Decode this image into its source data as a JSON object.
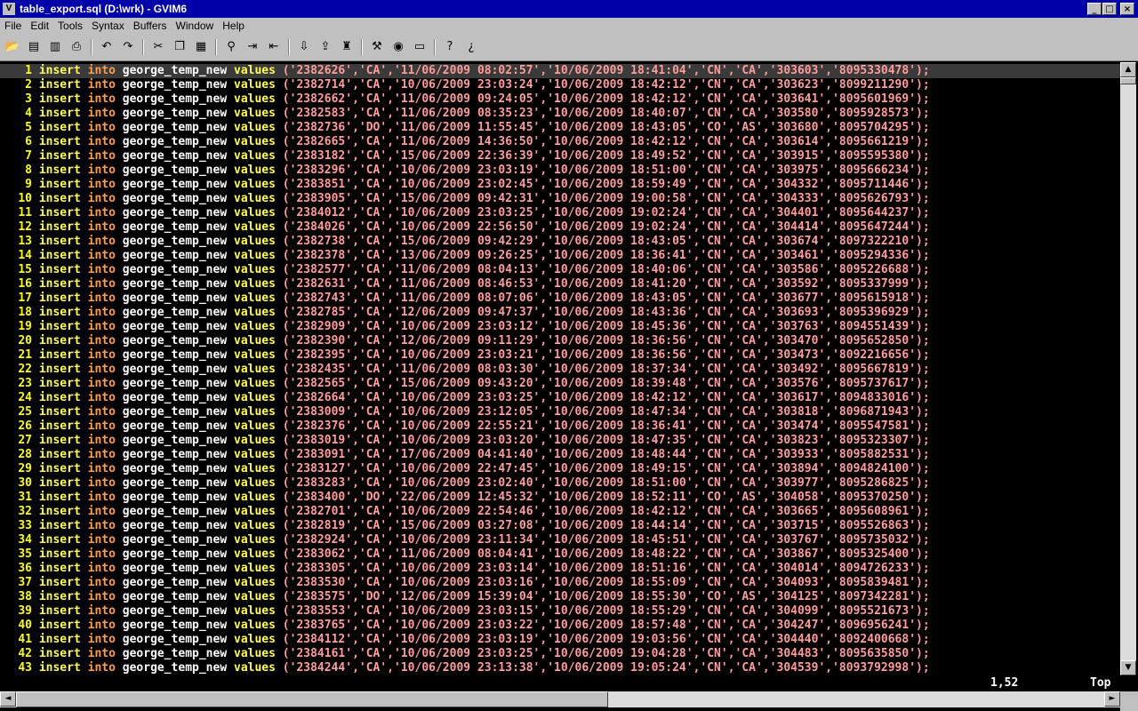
{
  "window": {
    "title": "table_export.sql (D:\\wrk) - GVIM6",
    "icon": "gvim-icon",
    "min_label": "_",
    "max_label": "□",
    "close_label": "×"
  },
  "menu": [
    "File",
    "Edit",
    "Tools",
    "Syntax",
    "Buffers",
    "Window",
    "Help"
  ],
  "toolbar": [
    {
      "name": "open-icon",
      "glyph": "📂"
    },
    {
      "name": "save-icon",
      "glyph": "▤"
    },
    {
      "name": "save-all-icon",
      "glyph": "▥"
    },
    {
      "name": "print-icon",
      "glyph": "⎙"
    },
    {
      "name": "undo-icon",
      "glyph": "↶"
    },
    {
      "name": "redo-icon",
      "glyph": "↷"
    },
    {
      "name": "cut-icon",
      "glyph": "✂"
    },
    {
      "name": "copy-icon",
      "glyph": "❐"
    },
    {
      "name": "paste-icon",
      "glyph": "▦"
    },
    {
      "name": "find-replace-icon",
      "glyph": "⚲"
    },
    {
      "name": "find-next-icon",
      "glyph": "⇥"
    },
    {
      "name": "find-prev-icon",
      "glyph": "⇤"
    },
    {
      "name": "load-session-icon",
      "glyph": "⇩"
    },
    {
      "name": "save-session-icon",
      "glyph": "⇪"
    },
    {
      "name": "run-script-icon",
      "glyph": "♜"
    },
    {
      "name": "make-icon",
      "glyph": "⚒"
    },
    {
      "name": "shell-icon",
      "glyph": "◉"
    },
    {
      "name": "ctags-icon",
      "glyph": "▭"
    },
    {
      "name": "help-icon",
      "glyph": "?"
    },
    {
      "name": "find-help-icon",
      "glyph": "¿"
    }
  ],
  "code": {
    "keyword_insert": "insert",
    "keyword_into": "into",
    "table": "george_temp_new",
    "keyword_values": "values",
    "lines": [
      "('2382626','CA','11/06/2009 08:02:57','10/06/2009 18:41:04','CN','CA','303603','8095330478');",
      "('2382714','CA','10/06/2009 23:03:24','10/06/2009 18:42:12','CN','CA','303623','8099211290');",
      "('2382662','CA','11/06/2009 09:24:05','10/06/2009 18:42:12','CN','CA','303641','8095601969');",
      "('2382583','CA','11/06/2009 08:35:23','10/06/2009 18:40:07','CN','CA','303580','8095928573');",
      "('2382736','DO','11/06/2009 11:55:45','10/06/2009 18:43:05','CO','AS','303680','8095704295');",
      "('2382665','CA','11/06/2009 14:36:50','10/06/2009 18:42:12','CN','CA','303614','8095661219');",
      "('2383182','CA','15/06/2009 22:36:39','10/06/2009 18:49:52','CN','CA','303915','8095595380');",
      "('2383296','CA','10/06/2009 23:03:19','10/06/2009 18:51:00','CN','CA','303975','8095666234');",
      "('2383851','CA','10/06/2009 23:02:45','10/06/2009 18:59:49','CN','CA','304332','8095711446');",
      "('2383905','CA','15/06/2009 09:42:31','10/06/2009 19:00:58','CN','CA','304333','8095626793');",
      "('2384012','CA','10/06/2009 23:03:25','10/06/2009 19:02:24','CN','CA','304401','8095644237');",
      "('2384026','CA','10/06/2009 22:56:50','10/06/2009 19:02:24','CN','CA','304414','8095647244');",
      "('2382738','CA','15/06/2009 09:42:29','10/06/2009 18:43:05','CN','CA','303674','8097322210');",
      "('2382378','CA','13/06/2009 09:26:25','10/06/2009 18:36:41','CN','CA','303461','8095294336');",
      "('2382577','CA','11/06/2009 08:04:13','10/06/2009 18:40:06','CN','CA','303586','8095226688');",
      "('2382631','CA','11/06/2009 08:46:53','10/06/2009 18:41:20','CN','CA','303592','8095337999');",
      "('2382743','CA','11/06/2009 08:07:06','10/06/2009 18:43:05','CN','CA','303677','8095615918');",
      "('2382785','CA','12/06/2009 09:47:37','10/06/2009 18:43:36','CN','CA','303693','8095396929');",
      "('2382909','CA','10/06/2009 23:03:12','10/06/2009 18:45:36','CN','CA','303763','8094551439');",
      "('2382390','CA','12/06/2009 09:11:29','10/06/2009 18:36:56','CN','CA','303470','8095652850');",
      "('2382395','CA','10/06/2009 23:03:21','10/06/2009 18:36:56','CN','CA','303473','8092216656');",
      "('2382435','CA','11/06/2009 08:03:30','10/06/2009 18:37:34','CN','CA','303492','8095667819');",
      "('2382565','CA','15/06/2009 09:43:20','10/06/2009 18:39:48','CN','CA','303576','8095737617');",
      "('2382664','CA','10/06/2009 23:03:25','10/06/2009 18:42:12','CN','CA','303617','8094833016');",
      "('2383009','CA','10/06/2009 23:12:05','10/06/2009 18:47:34','CN','CA','303818','8096871943');",
      "('2382376','CA','10/06/2009 22:55:21','10/06/2009 18:36:41','CN','CA','303474','8095547581');",
      "('2383019','CA','10/06/2009 23:03:20','10/06/2009 18:47:35','CN','CA','303823','8095323307');",
      "('2383091','CA','17/06/2009 04:41:40','10/06/2009 18:48:44','CN','CA','303933','8095882531');",
      "('2383127','CA','10/06/2009 22:47:45','10/06/2009 18:49:15','CN','CA','303894','8094824100');",
      "('2383283','CA','10/06/2009 23:02:40','10/06/2009 18:51:00','CN','CA','303977','8095286825');",
      "('2383400','DO','22/06/2009 12:45:32','10/06/2009 18:52:11','CO','AS','304058','8095370250');",
      "('2382701','CA','10/06/2009 22:54:46','10/06/2009 18:42:12','CN','CA','303665','8095608961');",
      "('2382819','CA','15/06/2009 03:27:08','10/06/2009 18:44:14','CN','CA','303715','8095526863');",
      "('2382924','CA','10/06/2009 23:11:34','10/06/2009 18:45:51','CN','CA','303767','8095735032');",
      "('2383062','CA','11/06/2009 08:04:41','10/06/2009 18:48:22','CN','CA','303867','8095325400');",
      "('2383305','CA','10/06/2009 23:03:14','10/06/2009 18:51:16','CN','CA','304014','8094726233');",
      "('2383530','CA','10/06/2009 23:03:16','10/06/2009 18:55:09','CN','CA','304093','8095839481');",
      "('2383575','DO','12/06/2009 15:39:04','10/06/2009 18:55:30','CO','AS','304125','8097342281');",
      "('2383553','CA','10/06/2009 23:03:15','10/06/2009 18:55:29','CN','CA','304099','8095521673');",
      "('2383765','CA','10/06/2009 23:03:22','10/06/2009 18:57:48','CN','CA','304247','8096956241');",
      "('2384112','CA','10/06/2009 23:03:19','10/06/2009 19:03:56','CN','CA','304440','8092400668');",
      "('2384161','CA','10/06/2009 23:03:25','10/06/2009 19:04:28','CN','CA','304483','8095635850');",
      "('2384244','CA','10/06/2009 23:13:38','10/06/2009 19:05:24','CN','CA','304539','8093792998');"
    ]
  },
  "status": {
    "position": "1,52",
    "scroll": "Top"
  },
  "scrollbar": {
    "up": "▲",
    "down": "▼",
    "left": "◄",
    "right": "►"
  },
  "colors": {
    "title_bar": "#0000a8",
    "line_number": "#ffff00",
    "keyword": "#ffff54",
    "keyword_into": "#ff9e4a",
    "string": "#ff9c9c",
    "cursor_line": "#3a3a3a"
  }
}
